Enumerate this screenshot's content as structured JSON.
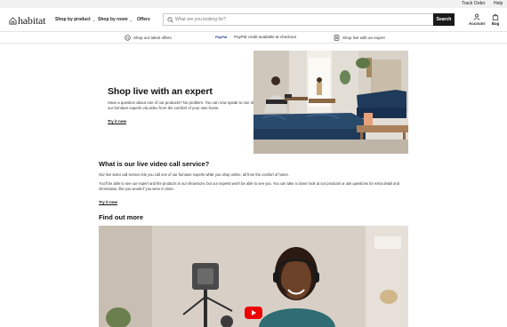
{
  "utility_links": {
    "track_order": "Track Order",
    "help": "Help"
  },
  "brand": {
    "name": "habitat"
  },
  "nav": [
    {
      "label": "Shop by product",
      "has_dropdown": true
    },
    {
      "label": "Shop by room",
      "has_dropdown": true
    },
    {
      "label": "Offers",
      "has_dropdown": false
    }
  ],
  "search": {
    "placeholder": "What are you looking for?",
    "value": "",
    "button_label": "Search"
  },
  "account": {
    "account_label": "Account",
    "bag_label": "Bag"
  },
  "promos": [
    {
      "icon": "offer-tag-icon",
      "text": "Shop our latest offers"
    },
    {
      "icon": "paypal-logo-icon",
      "badge": "PayPal",
      "text": "PayPal credit available at checkout"
    },
    {
      "icon": "video-call-icon",
      "text": "Shop live with an expert"
    }
  ],
  "hero": {
    "title": "Shop live with an expert",
    "body": "Have a question about one of our products? No problem. You can now speak to one of our furniture experts via video from the comfort of your own home.",
    "cta": "Try it now"
  },
  "what_is": {
    "title": "What is our live video call service?",
    "p1": "Our live video call service lets you call one of our furniture experts while you shop online, all from the comfort of home.",
    "p2": "You'll be able to see our expert and the products in our showroom, but our experts won't be able to see you. You can take a closer look at our products or ask questions for extra detail and information, like you would if you were in store.",
    "cta": "Try it now"
  },
  "find_out_more": {
    "title": "Find out more"
  },
  "colors": {
    "search_button": "#1b1b1b",
    "youtube_red": "#ee0000",
    "sofa_blue": "#1f3a5a"
  }
}
